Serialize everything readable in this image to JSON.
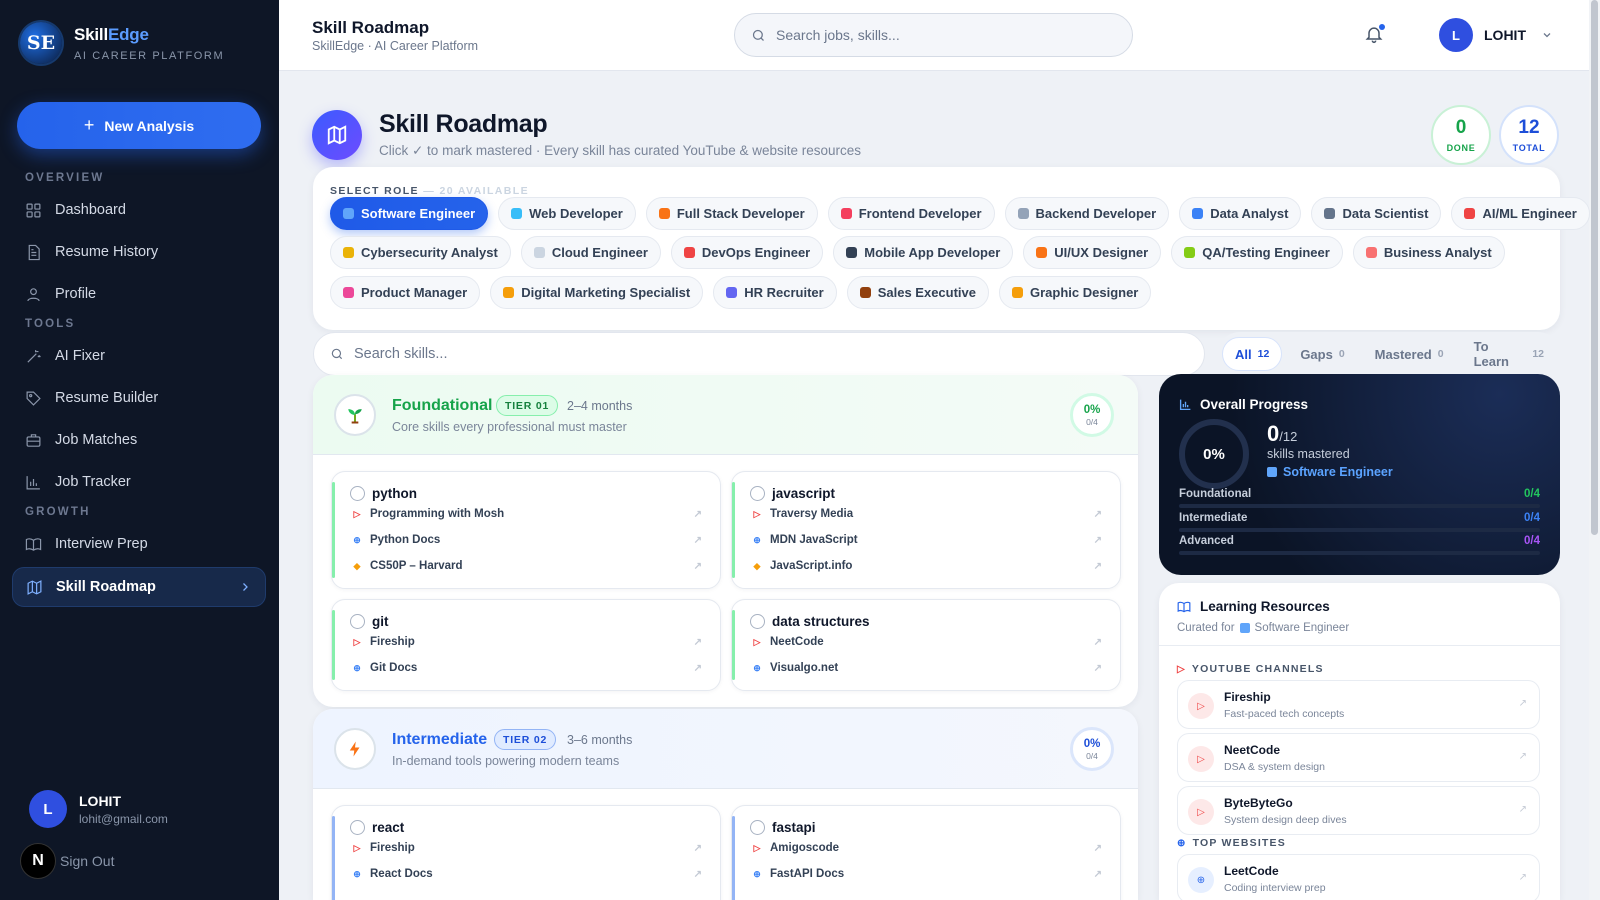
{
  "brand": {
    "name_a": "Skill",
    "name_b": "Edge",
    "subtitle": "AI CAREER PLATFORM",
    "logo_text": "SE"
  },
  "sidebar": {
    "new_analysis": "New Analysis",
    "sections": [
      "OVERVIEW",
      "TOOLS",
      "GROWTH"
    ],
    "items": [
      {
        "label": "Dashboard",
        "icon": "grid-icon"
      },
      {
        "label": "Resume History",
        "icon": "document-icon"
      },
      {
        "label": "Profile",
        "icon": "user-icon"
      },
      {
        "label": "AI Fixer",
        "icon": "magic-wand-icon"
      },
      {
        "label": "Resume Builder",
        "icon": "tag-icon"
      },
      {
        "label": "Job Matches",
        "icon": "briefcase-icon"
      },
      {
        "label": "Job Tracker",
        "icon": "bar-chart-icon"
      },
      {
        "label": "Interview Prep",
        "icon": "book-icon"
      },
      {
        "label": "Skill Roadmap",
        "icon": "map-icon"
      }
    ],
    "active": "Skill Roadmap",
    "user": {
      "initial": "L",
      "name": "LOHIT",
      "email": "lohit@gmail.com"
    },
    "sign_out": "Sign Out",
    "n_badge": "N"
  },
  "topbar": {
    "title": "Skill Roadmap",
    "subtitle": "SkillEdge · AI Career Platform",
    "search_placeholder": "Search jobs, skills...",
    "user_initial": "L",
    "user_name": "LOHIT"
  },
  "page": {
    "title": "Skill Roadmap",
    "subtitle": "Click ✓ to mark mastered · Every skill has curated YouTube & website resources",
    "done_value": "0",
    "done_label": "DONE",
    "total_value": "12",
    "total_label": "TOTAL"
  },
  "roles": {
    "heading": "SELECT ROLE",
    "available": "— 20 AVAILABLE",
    "items": [
      {
        "label": "Software Engineer",
        "color": "#60a5fa"
      },
      {
        "label": "Web Developer",
        "color": "#38bdf8"
      },
      {
        "label": "Full Stack Developer",
        "color": "#f97316"
      },
      {
        "label": "Frontend Developer",
        "color": "#f43f5e"
      },
      {
        "label": "Backend Developer",
        "color": "#94a3b8"
      },
      {
        "label": "Data Analyst",
        "color": "#3b82f6"
      },
      {
        "label": "Data Scientist",
        "color": "#64748b"
      },
      {
        "label": "AI/ML Engineer",
        "color": "#ef4444"
      },
      {
        "label": "Cybersecurity Analyst",
        "color": "#eab308"
      },
      {
        "label": "Cloud Engineer",
        "color": "#cbd5e1"
      },
      {
        "label": "DevOps Engineer",
        "color": "#ef4444"
      },
      {
        "label": "Mobile App Developer",
        "color": "#334155"
      },
      {
        "label": "UI/UX Designer",
        "color": "#f97316"
      },
      {
        "label": "QA/Testing Engineer",
        "color": "#84cc16"
      },
      {
        "label": "Business Analyst",
        "color": "#f87171"
      },
      {
        "label": "Product Manager",
        "color": "#ec4899"
      },
      {
        "label": "Digital Marketing Specialist",
        "color": "#f59e0b"
      },
      {
        "label": "HR Recruiter",
        "color": "#6366f1"
      },
      {
        "label": "Sales Executive",
        "color": "#92400e"
      },
      {
        "label": "Graphic Designer",
        "color": "#f59e0b"
      }
    ]
  },
  "skill_search": {
    "placeholder": "Search skills..."
  },
  "filters": [
    {
      "label": "All",
      "count": "12"
    },
    {
      "label": "Gaps",
      "count": "0"
    },
    {
      "label": "Mastered",
      "count": "0"
    },
    {
      "label": "To Learn",
      "count": "12"
    }
  ],
  "tiers": [
    {
      "name": "Foundational",
      "badge": "TIER 01",
      "duration": "2–4 months",
      "desc": "Core skills every professional must master",
      "pct": "0%",
      "frac": "0/4",
      "color": "#16a34a",
      "icon": "sprout-icon",
      "skills": [
        {
          "name": "python",
          "res": [
            {
              "t": "Programming with Mosh",
              "k": "youtube"
            },
            {
              "t": "Python Docs",
              "k": "web"
            },
            {
              "t": "CS50P – Harvard",
              "k": "course"
            }
          ]
        },
        {
          "name": "javascript",
          "res": [
            {
              "t": "Traversy Media",
              "k": "youtube"
            },
            {
              "t": "MDN JavaScript",
              "k": "web"
            },
            {
              "t": "JavaScript.info",
              "k": "course"
            }
          ]
        },
        {
          "name": "git",
          "res": [
            {
              "t": "Fireship",
              "k": "youtube"
            },
            {
              "t": "Git Docs",
              "k": "web"
            }
          ]
        },
        {
          "name": "data structures",
          "res": [
            {
              "t": "NeetCode",
              "k": "youtube"
            },
            {
              "t": "Visualgo.net",
              "k": "web"
            }
          ]
        }
      ]
    },
    {
      "name": "Intermediate",
      "badge": "TIER 02",
      "duration": "3–6 months",
      "desc": "In-demand tools powering modern teams",
      "pct": "0%",
      "frac": "0/4",
      "color": "#2563eb",
      "icon": "lightning-icon",
      "skills": [
        {
          "name": "react",
          "res": [
            {
              "t": "Fireship",
              "k": "youtube"
            },
            {
              "t": "React Docs",
              "k": "web"
            }
          ]
        },
        {
          "name": "fastapi",
          "res": [
            {
              "t": "Amigoscode",
              "k": "youtube"
            },
            {
              "t": "FastAPI Docs",
              "k": "web"
            }
          ]
        }
      ]
    }
  ],
  "progress": {
    "title": "Overall Progress",
    "pct": "0%",
    "done": "0",
    "of": "/12",
    "label": "skills mastered",
    "role": "Software Engineer",
    "rows": [
      {
        "label": "Foundational",
        "frac": "0/4",
        "color": "#22c55e",
        "fill": 0
      },
      {
        "label": "Intermediate",
        "frac": "0/4",
        "color": "#3b82f6",
        "fill": 0
      },
      {
        "label": "Advanced",
        "frac": "0/4",
        "color": "#a855f7",
        "fill": 0
      }
    ]
  },
  "resources": {
    "title": "Learning Resources",
    "curated_prefix": "Curated for",
    "role": "Software Engineer",
    "yt_heading": "YOUTUBE CHANNELS",
    "web_heading": "TOP WEBSITES",
    "youtube": [
      {
        "name": "Fireship",
        "desc": "Fast-paced tech concepts"
      },
      {
        "name": "NeetCode",
        "desc": "DSA & system design"
      },
      {
        "name": "ByteByteGo",
        "desc": "System design deep dives"
      }
    ],
    "websites": [
      {
        "name": "LeetCode",
        "desc": "Coding interview prep"
      }
    ]
  }
}
